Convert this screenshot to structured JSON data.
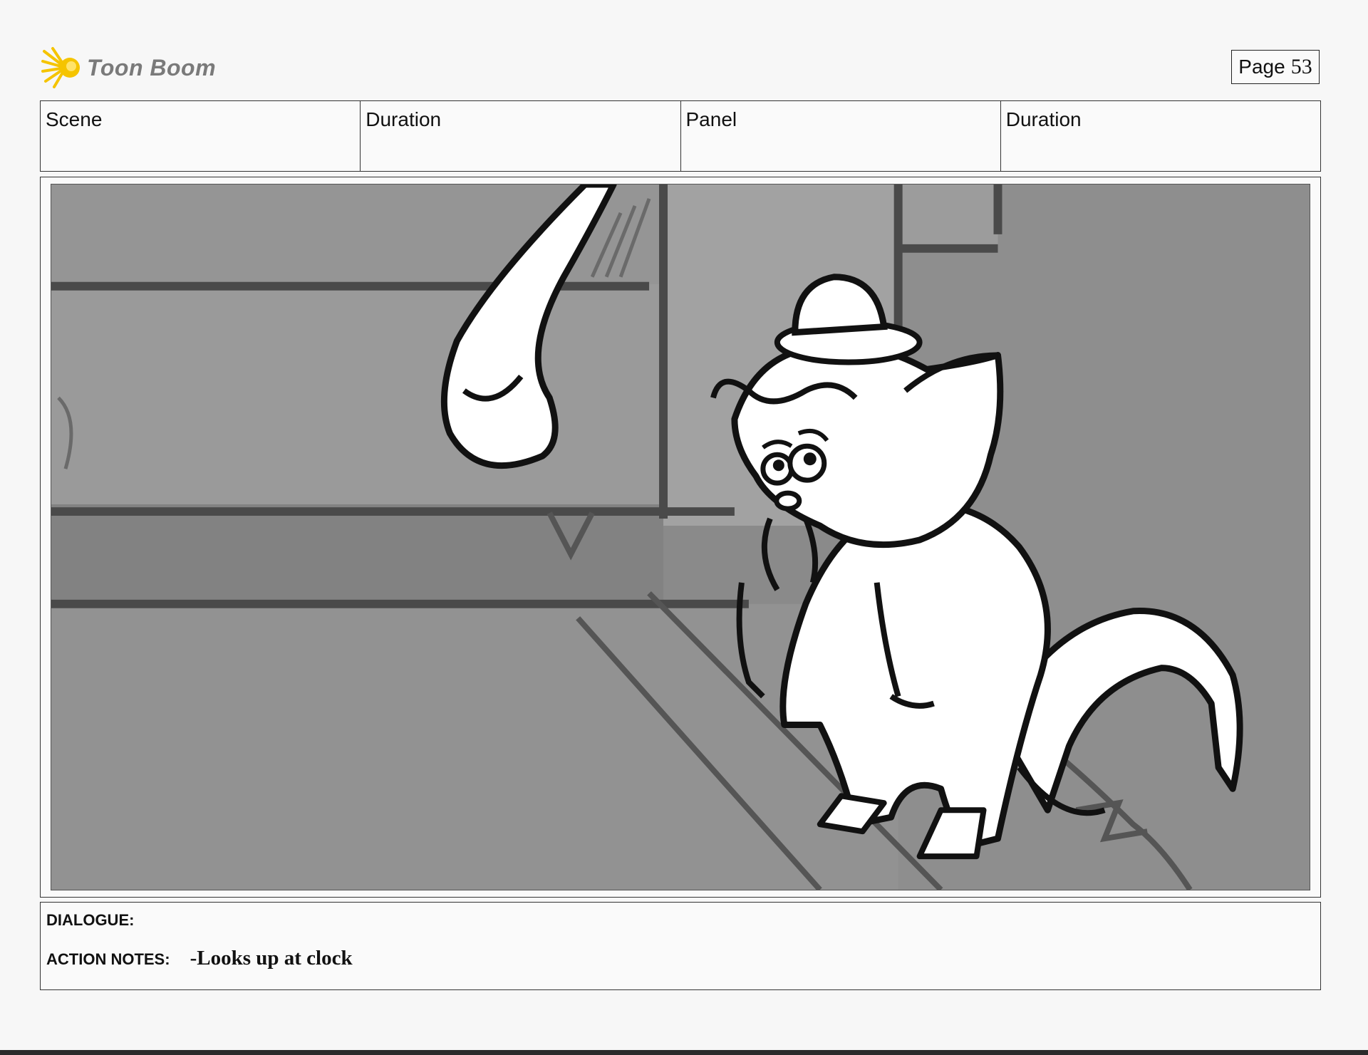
{
  "brand": {
    "logo_text": "Toon Boom",
    "logo_icon": "starburst-logo-icon",
    "accent": "#f5c400"
  },
  "page": {
    "label": "Page",
    "number": "53"
  },
  "header": {
    "scene_label": "Scene",
    "scene_duration_label": "Duration",
    "panel_label": "Panel",
    "panel_duration_label": "Duration"
  },
  "notes": {
    "dialogue_label": "DIALOGUE:",
    "dialogue_value": "",
    "action_label": "ACTION NOTES:",
    "action_value": "-Looks up at clock"
  }
}
